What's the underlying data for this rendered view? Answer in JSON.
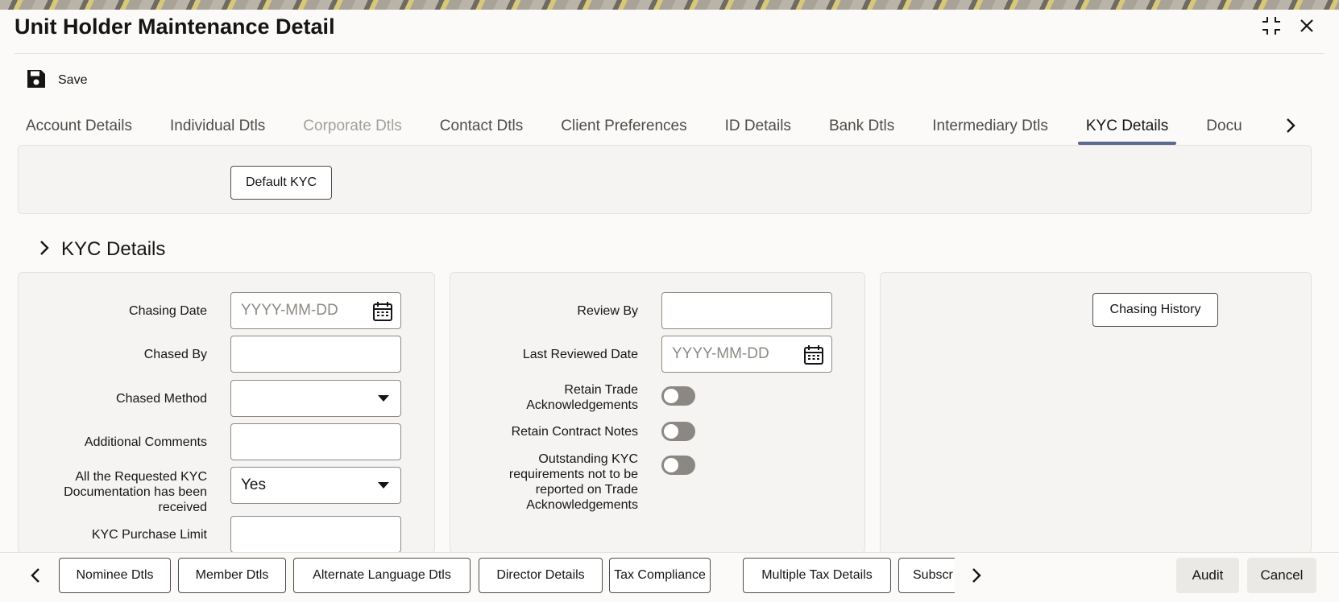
{
  "window": {
    "title": "Unit Holder Maintenance Detail",
    "icons": {
      "minimize": "collapse-icon",
      "close": "close-icon"
    }
  },
  "toolbar": {
    "save_label": "Save",
    "save_icon": "save-icon"
  },
  "tabs": [
    {
      "label": "Account Details",
      "state": "normal"
    },
    {
      "label": "Individual Dtls",
      "state": "normal"
    },
    {
      "label": "Corporate Dtls",
      "state": "disabled"
    },
    {
      "label": "Contact Dtls",
      "state": "normal"
    },
    {
      "label": "Client Preferences",
      "state": "normal"
    },
    {
      "label": "ID Details",
      "state": "normal"
    },
    {
      "label": "Bank Dtls",
      "state": "normal"
    },
    {
      "label": "Intermediary Dtls",
      "state": "normal"
    },
    {
      "label": "KYC Details",
      "state": "active"
    },
    {
      "label": "Docu",
      "state": "normal"
    }
  ],
  "top_panel": {
    "default_kyc_label": "Default KYC"
  },
  "section": {
    "title": "KYC Details"
  },
  "left_form": {
    "chasing_date": {
      "label": "Chasing Date",
      "placeholder": "YYYY-MM-DD"
    },
    "chased_by": {
      "label": "Chased By",
      "value": ""
    },
    "chased_method": {
      "label": "Chased Method",
      "value": ""
    },
    "additional_comments": {
      "label": "Additional Comments",
      "value": ""
    },
    "requested_docs": {
      "label": "All the Requested KYC Documentation has been received",
      "value": "Yes"
    },
    "purchase_limit": {
      "label": "KYC Purchase Limit",
      "value": ""
    }
  },
  "middle_form": {
    "review_by": {
      "label": "Review By",
      "value": ""
    },
    "last_reviewed_date": {
      "label": "Last Reviewed Date",
      "placeholder": "YYYY-MM-DD"
    },
    "retain_trade_ack": {
      "label": "Retain Trade Acknowledgements",
      "on": false
    },
    "retain_contract_notes": {
      "label": "Retain Contract Notes",
      "on": false
    },
    "outstanding_kyc": {
      "label": "Outstanding KYC requirements not to be reported on Trade Acknowledgements",
      "on": false
    }
  },
  "right_panel": {
    "chasing_history_label": "Chasing History"
  },
  "footer": {
    "buttons": [
      "Nominee Dtls",
      "Member Dtls",
      "Alternate Language Dtls",
      "Director Details",
      "Tax Compliance",
      "Multiple Tax Details",
      "Subscr"
    ],
    "audit_label": "Audit",
    "cancel_label": "Cancel"
  },
  "colors": {
    "active_tab_underline": "#5b6a8f",
    "toggle_off": "#8b8782"
  }
}
